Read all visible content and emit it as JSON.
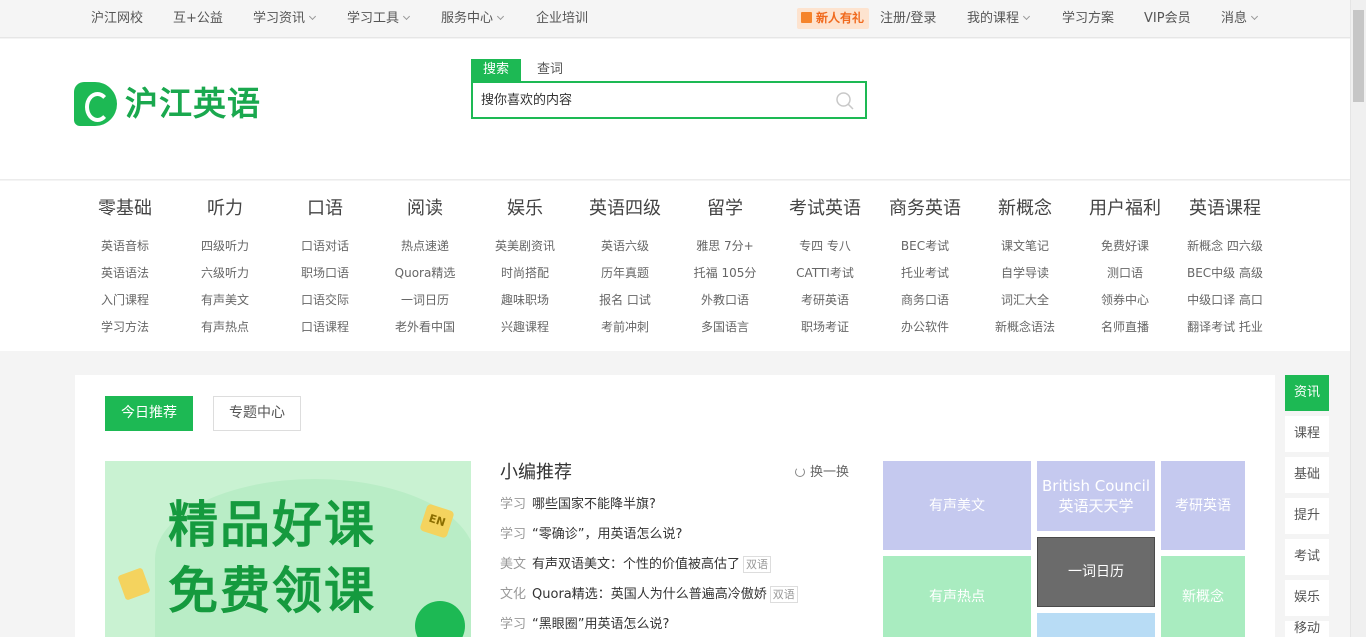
{
  "topbar": {
    "items": [
      {
        "label": "沪江网校",
        "dropdown": false
      },
      {
        "label": "互+公益",
        "dropdown": false
      },
      {
        "label": "学习资讯",
        "dropdown": true
      },
      {
        "label": "学习工具",
        "dropdown": true
      },
      {
        "label": "服务中心",
        "dropdown": true
      },
      {
        "label": "企业培训",
        "dropdown": false
      }
    ],
    "gift_label": "新人有礼",
    "right_items": [
      {
        "label": "注册/登录",
        "dropdown": false
      },
      {
        "label": "我的课程",
        "dropdown": true
      },
      {
        "label": "学习方案",
        "dropdown": false
      },
      {
        "label": "VIP会员",
        "dropdown": false
      },
      {
        "label": "消息",
        "dropdown": true
      }
    ]
  },
  "header": {
    "logo_text": "沪江英语",
    "search_tabs": [
      "搜索",
      "查词"
    ],
    "search_placeholder": "搜你喜欢的内容",
    "colors": {
      "brand": "#1db954"
    }
  },
  "categories": [
    {
      "head": "零基础",
      "links": [
        "英语音标",
        "英语语法",
        "入门课程",
        "学习方法"
      ]
    },
    {
      "head": "听力",
      "links": [
        "四级听力",
        "六级听力",
        "有声美文",
        "有声热点"
      ]
    },
    {
      "head": "口语",
      "links": [
        "口语对话",
        "职场口语",
        "口语交际",
        "口语课程"
      ]
    },
    {
      "head": "阅读",
      "links": [
        "热点速递",
        "Quora精选",
        "一词日历",
        "老外看中国"
      ]
    },
    {
      "head": "娱乐",
      "links": [
        "英美剧资讯",
        "时尚搭配",
        "趣味职场",
        "兴趣课程"
      ]
    },
    {
      "head": "英语四级",
      "links": [
        "英语六级",
        "历年真题",
        "报名 口试",
        "考前冲刺"
      ]
    },
    {
      "head": "留学",
      "links": [
        "雅思 7分+",
        "托福 105分",
        "外教口语",
        "多国语言"
      ]
    },
    {
      "head": "考试英语",
      "links": [
        "专四 专八",
        "CATTI考试",
        "考研英语",
        "职场考证"
      ]
    },
    {
      "head": "商务英语",
      "links": [
        "BEC考试",
        "托业考试",
        "商务口语",
        "办公软件"
      ]
    },
    {
      "head": "新概念",
      "links": [
        "课文笔记",
        "自学导读",
        "词汇大全",
        "新概念语法"
      ]
    },
    {
      "head": "用户福利",
      "links": [
        "免费好课",
        "测口语",
        "领券中心",
        "名师直播"
      ]
    },
    {
      "head": "英语课程",
      "links": [
        "新概念 四六级",
        "BEC中级 高级",
        "中级口译 高口",
        "翻译考试 托业"
      ]
    }
  ],
  "main": {
    "tabs": [
      "今日推荐",
      "专题中心"
    ],
    "banner": {
      "line1": "精品好课",
      "line2": "免费领课",
      "badge": "EN"
    },
    "editor": {
      "title": "小编推荐",
      "refresh_label": "换一换",
      "news": [
        {
          "cat": "学习",
          "text": "哪些国家不能降半旗?",
          "tag": ""
        },
        {
          "cat": "学习",
          "text": "“零确诊”，用英语怎么说?",
          "tag": ""
        },
        {
          "cat": "美文",
          "text": "有声双语美文：个性的价值被高估了",
          "tag": "双语"
        },
        {
          "cat": "文化",
          "text": "Quora精选：英国人为什么普遍高冷傲娇",
          "tag": "双语"
        },
        {
          "cat": "学习",
          "text": "“黑眼圈”用英语怎么说?",
          "tag": ""
        }
      ]
    },
    "tiles": [
      {
        "label": "有声美文",
        "color": "#c5c9ef"
      },
      {
        "label": "British Council\n英语天天学",
        "color": "#c5c9ef"
      },
      {
        "label": "考研英语",
        "color": "#c5c9ef"
      },
      {
        "label": "一词日历",
        "color": "#6b6b6b"
      },
      {
        "label": "有声热点",
        "color": "#a9ecc0"
      },
      {
        "label": "新概念",
        "color": "#a9ecc0"
      },
      {
        "label": "",
        "color": "#b8dcf5"
      }
    ]
  },
  "right_nav": [
    "资讯",
    "课程",
    "基础",
    "提升",
    "考试",
    "娱乐",
    "移动"
  ]
}
